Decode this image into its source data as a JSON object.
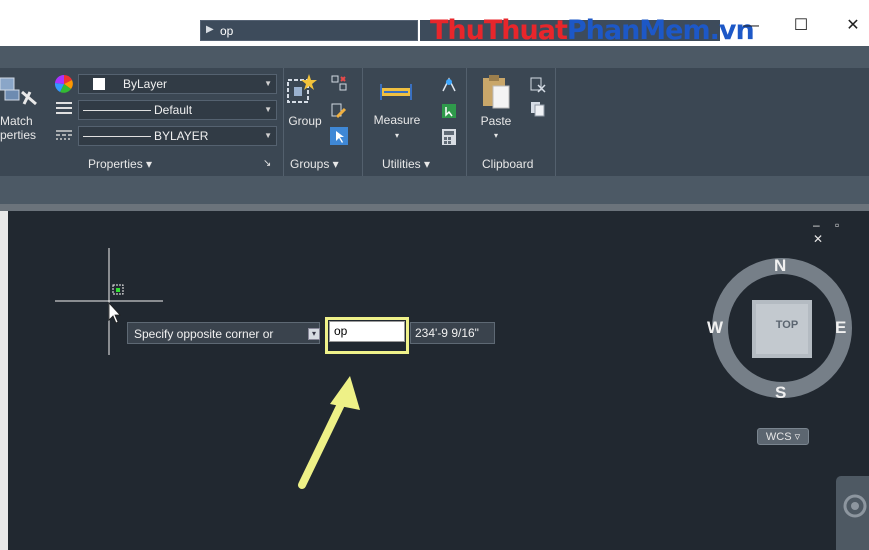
{
  "search": {
    "value": "op"
  },
  "watermark": {
    "part1": "ThuThuat",
    "part2": "PhanMem",
    "part3": ".vn"
  },
  "window_controls": {
    "minimize": "—",
    "maximize": "☐",
    "close": "✕"
  },
  "ribbon": {
    "match_properties": {
      "line1": "Match",
      "line2": "perties"
    },
    "layer_dropdown": "ByLayer",
    "linetype_dropdown": "Default",
    "lineweight_dropdown": "BYLAYER",
    "properties_label": "Properties ▾",
    "panel_launcher": "↘",
    "group_label": "Group",
    "groups_label": "Groups ▾",
    "measure_label": "Measure",
    "measure_caret": "▾",
    "utilities_label": "Utilities ▾",
    "paste_label": "Paste",
    "paste_caret": "▾",
    "clipboard_label": "Clipboard"
  },
  "canvas": {
    "prompt_text": "Specify opposite corner or",
    "command_input": "op",
    "distance_readout": "234'-9 9/16\"",
    "viewport_controls": "– ▫ ✕"
  },
  "viewcube": {
    "north": "N",
    "south": "S",
    "east": "E",
    "west": "W",
    "face": "TOP",
    "wcs_label": "WCS ▿"
  },
  "colors": {
    "canvas_bg": "#212830",
    "ribbon_bg": "#3b4753",
    "highlight": "#f0f28a",
    "arrow": "#eef187"
  }
}
